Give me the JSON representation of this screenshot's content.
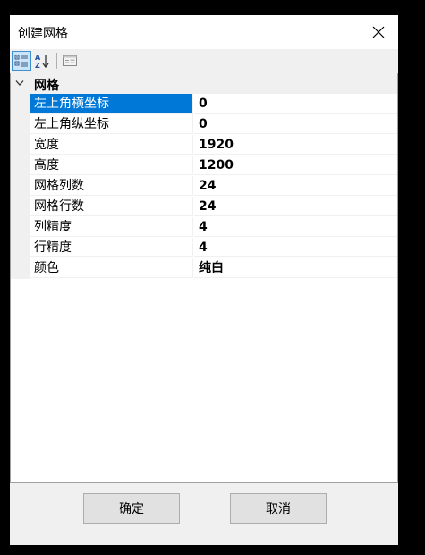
{
  "window": {
    "title": "创建网格"
  },
  "toolbar": {
    "categorized_icon": "categorized-view-icon",
    "alphabetical_icon": "alphabetical-sort-icon",
    "property_pages_icon": "property-pages-icon"
  },
  "grid": {
    "category": "网格",
    "rows": [
      {
        "name": "左上角横坐标",
        "value": "0"
      },
      {
        "name": "左上角纵坐标",
        "value": "0"
      },
      {
        "name": "宽度",
        "value": "1920"
      },
      {
        "name": "高度",
        "value": "1200"
      },
      {
        "name": "网格列数",
        "value": "24"
      },
      {
        "name": "网格行数",
        "value": "24"
      },
      {
        "name": "列精度",
        "value": "4"
      },
      {
        "name": "行精度",
        "value": "4"
      },
      {
        "name": "颜色",
        "value": "纯白"
      }
    ]
  },
  "buttons": {
    "ok": "确定",
    "cancel": "取消"
  },
  "colors": {
    "selection": "#0078d7",
    "toolbar_active": "#cce4f7"
  }
}
